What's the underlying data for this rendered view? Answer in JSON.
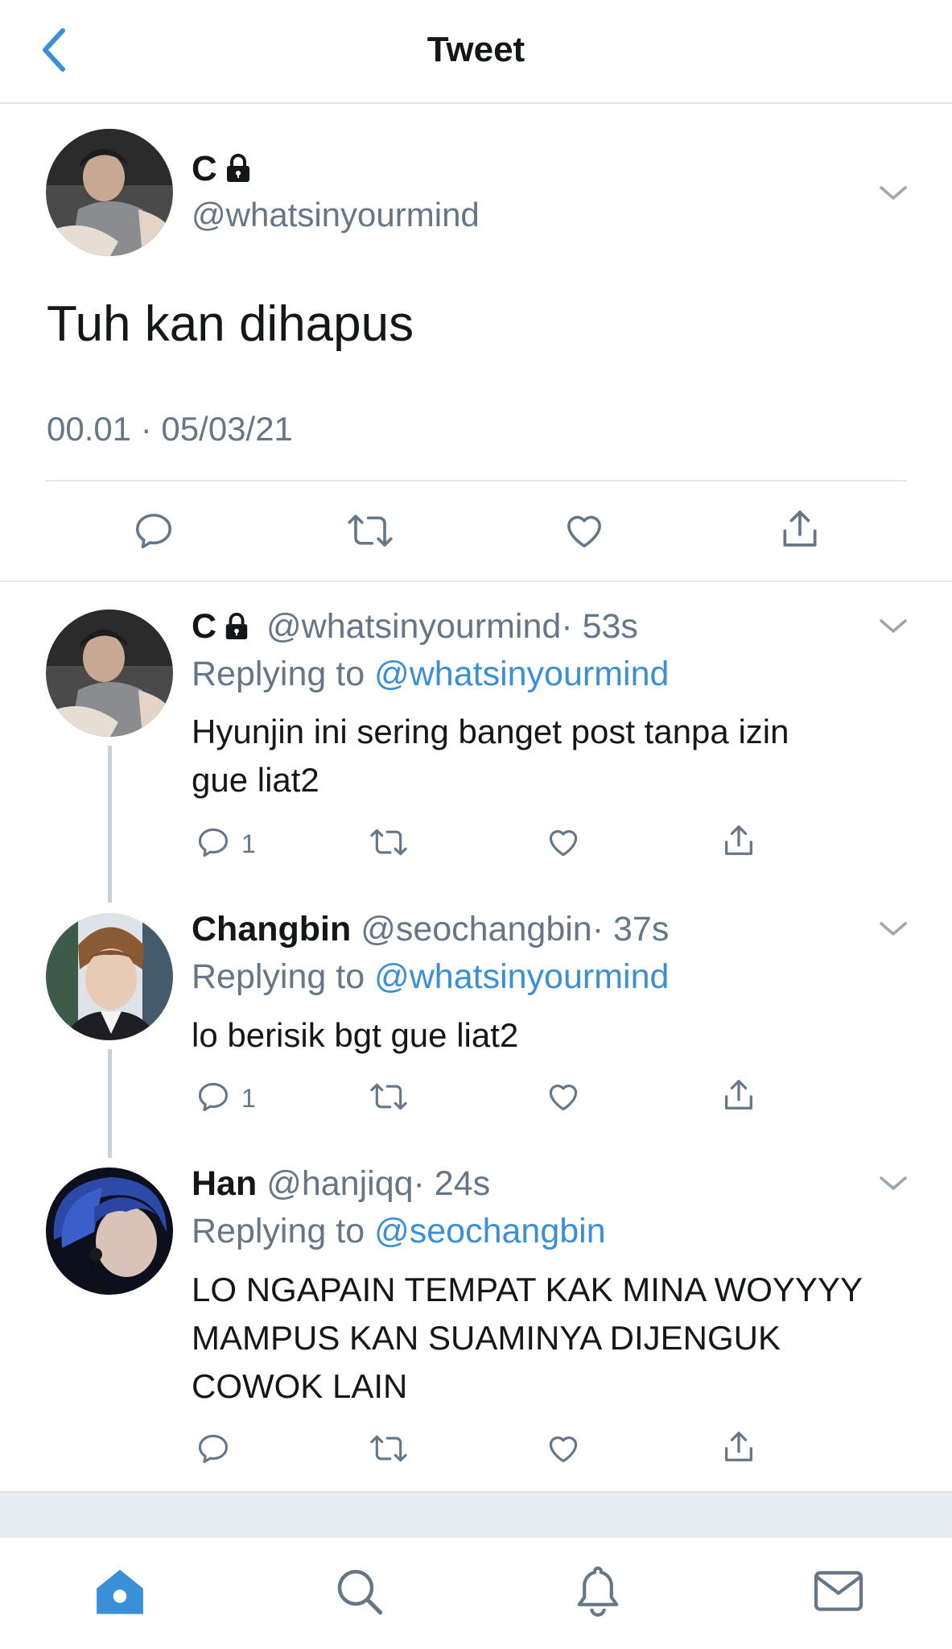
{
  "header": {
    "title": "Tweet"
  },
  "main_tweet": {
    "name": "C",
    "handle": "@whatsinyourmind",
    "text": "Tuh kan dihapus",
    "timestamp": "00.01 · 05/03/21"
  },
  "replies": [
    {
      "name": "C",
      "handle": "@whatsinyourmind",
      "time": "· 53s",
      "replying_label": "Replying to",
      "replying_to": "@whatsinyourmind",
      "text_line1": "Hyunjin ini sering banget post tanpa izin",
      "text_line2": "gue liat2",
      "reply_count": "1"
    },
    {
      "name": "Changbin",
      "handle": "@seochangbin",
      "time": "· 37s",
      "replying_label": "Replying to",
      "replying_to": "@whatsinyourmind",
      "text_line1": "lo berisik bgt gue liat2",
      "reply_count": "1"
    },
    {
      "name": "Han",
      "handle": "@hanjiqq",
      "time": "· 24s",
      "replying_label": "Replying to",
      "replying_to": "@seochangbin",
      "text_line1": "LO NGAPAIN TEMPAT KAK MINA WOYYYY",
      "text_line2": "MAMPUS KAN SUAMINYA DIJENGUK",
      "text_line3": "COWOK LAIN",
      "reply_count": ""
    }
  ],
  "tabbar": {
    "items": [
      {
        "icon": "home-icon",
        "active": true
      },
      {
        "icon": "search-icon",
        "active": false
      },
      {
        "icon": "bell-icon",
        "active": false
      },
      {
        "icon": "mail-icon",
        "active": false
      }
    ]
  },
  "colors": {
    "accent": "#3a8fd6",
    "text": "#14171a",
    "secondary": "#657786",
    "divider": "#e1e8ed"
  }
}
